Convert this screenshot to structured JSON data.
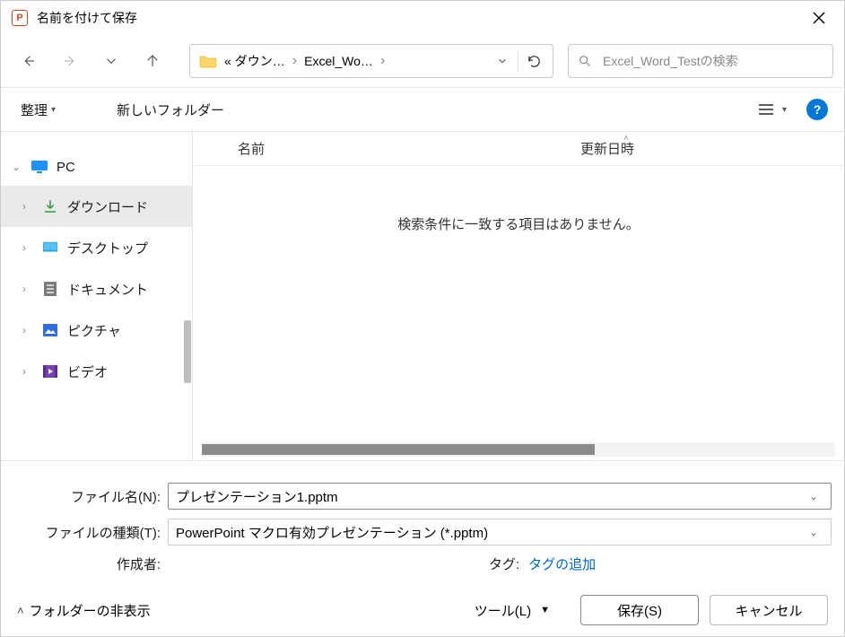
{
  "title": "名前を付けて保存",
  "breadcrumb": {
    "prefix": "«",
    "part1": "ダウン…",
    "part2": "Excel_Wo…"
  },
  "search": {
    "placeholder": "Excel_Word_Testの検索"
  },
  "toolbar": {
    "organize": "整理",
    "newFolder": "新しいフォルダー",
    "help": "?"
  },
  "tree": {
    "pc": "PC",
    "items": [
      {
        "label": "ダウンロード"
      },
      {
        "label": "デスクトップ"
      },
      {
        "label": "ドキュメント"
      },
      {
        "label": "ピクチャ"
      },
      {
        "label": "ビデオ"
      }
    ]
  },
  "list": {
    "col_name": "名前",
    "col_date": "更新日時",
    "empty": "検索条件に一致する項目はありません。"
  },
  "footer": {
    "filename_label": "ファイル名(N):",
    "filename_value": "プレゼンテーション1.pptm",
    "filetype_label": "ファイルの種類(T):",
    "filetype_value": "PowerPoint マクロ有効プレゼンテーション (*.pptm)",
    "author_label": "作成者:",
    "author_value": "",
    "tag_label": "タグ:",
    "tag_link": "タグの追加"
  },
  "bottom": {
    "hide_folders": "フォルダーの非表示",
    "tools": "ツール(L)",
    "save": "保存(S)",
    "cancel": "キャンセル"
  }
}
